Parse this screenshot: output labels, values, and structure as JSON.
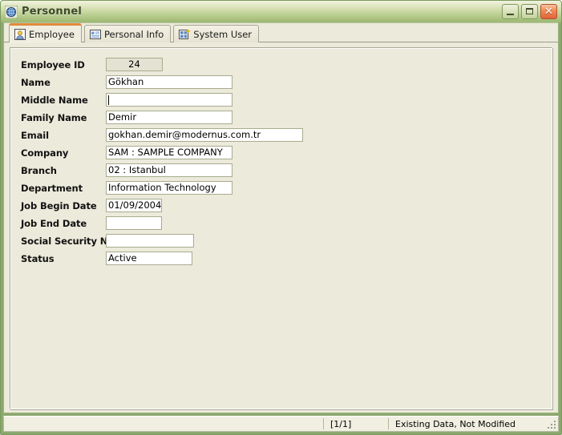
{
  "window": {
    "title": "Personnel",
    "icon": "globe-icon",
    "controls": {
      "minimize_label": "Minimize",
      "maximize_label": "Maximize",
      "close_label": "Close"
    },
    "frame_color": "#8ca86e",
    "titlebar_accent": "#b2c888"
  },
  "tabs": [
    {
      "label": "Employee",
      "icon": "user-card-icon",
      "active": true
    },
    {
      "label": "Personal Info",
      "icon": "list-card-icon",
      "active": false
    },
    {
      "label": "System User",
      "icon": "user-add-icon",
      "active": false
    }
  ],
  "form": {
    "fields": [
      {
        "label": "Employee ID",
        "value": "24",
        "type": "readonly",
        "width": "w-id",
        "name": "employee-id"
      },
      {
        "label": "Name",
        "value": "Gökhan",
        "type": "text",
        "width": "w-std",
        "name": "name"
      },
      {
        "label": "Middle Name",
        "value": "",
        "type": "focused",
        "width": "w-std",
        "name": "middle-name"
      },
      {
        "label": "Family Name",
        "value": "Demir",
        "type": "text",
        "width": "w-std",
        "name": "family-name"
      },
      {
        "label": "Email",
        "value": "gokhan.demir@modernus.com.tr",
        "type": "text",
        "width": "w-email",
        "name": "email"
      },
      {
        "label": "Company",
        "value": "SAM : SAMPLE COMPANY",
        "type": "text",
        "width": "w-std",
        "name": "company"
      },
      {
        "label": "Branch",
        "value": "02 : Istanbul",
        "type": "text",
        "width": "w-std",
        "name": "branch"
      },
      {
        "label": "Department",
        "value": "Information Technology",
        "type": "text",
        "width": "w-std",
        "name": "department"
      },
      {
        "label": "Job Begin Date",
        "value": "01/09/2004",
        "type": "text",
        "width": "w-date",
        "name": "job-begin-date"
      },
      {
        "label": "Job End Date",
        "value": "",
        "type": "text",
        "width": "w-date",
        "name": "job-end-date"
      },
      {
        "label": "Social Security No",
        "value": "",
        "type": "text",
        "width": "w-ssn",
        "name": "social-security-no"
      },
      {
        "label": "Status",
        "value": "Active",
        "type": "text",
        "width": "w-status",
        "name": "status"
      }
    ]
  },
  "statusbar": {
    "left": "",
    "pages": "[1/1]",
    "state": "Existing Data, Not Modified"
  }
}
